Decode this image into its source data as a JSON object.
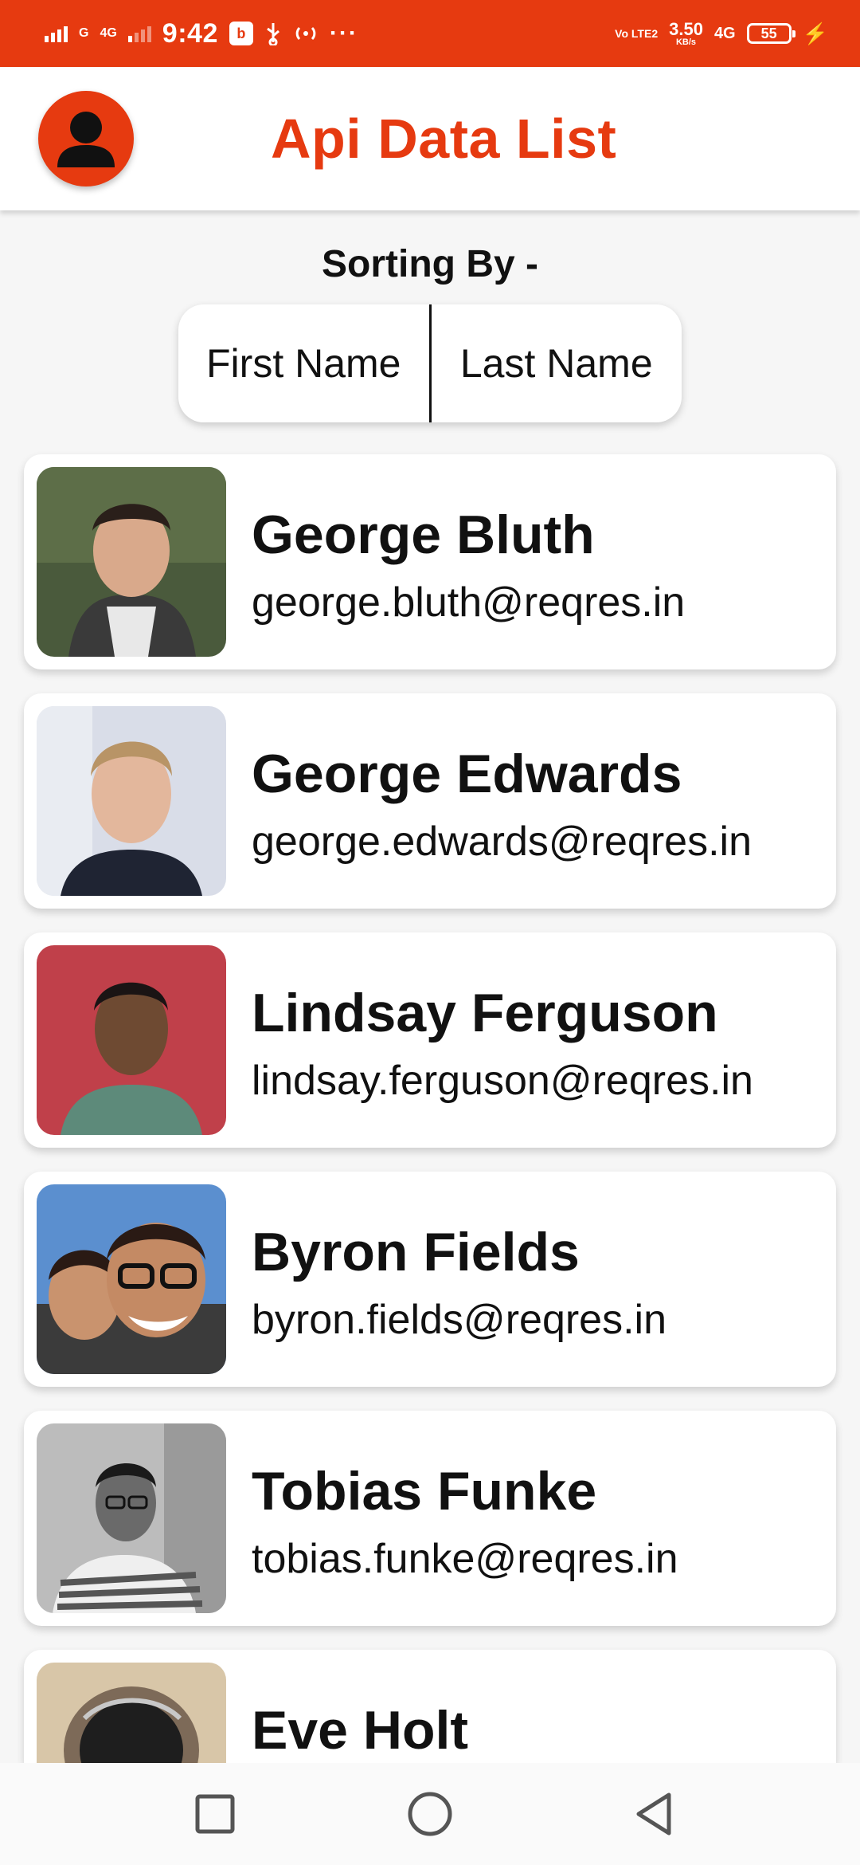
{
  "status_bar": {
    "network_1": "G",
    "network_2": "4G",
    "time": "9:42",
    "volte": "Vo LTE2",
    "speed_value": "3.50",
    "speed_unit": "KB/s",
    "network_3": "4G",
    "battery": "55",
    "accent": "#e63a10"
  },
  "appbar": {
    "title": "Api Data List",
    "avatar_icon": "person-icon"
  },
  "sorting": {
    "label": "Sorting By -",
    "options": [
      "First Name",
      "Last Name"
    ]
  },
  "users": [
    {
      "name": "George Bluth",
      "email": "george.bluth@reqres.in"
    },
    {
      "name": "George Edwards",
      "email": "george.edwards@reqres.in"
    },
    {
      "name": "Lindsay Ferguson",
      "email": "lindsay.ferguson@reqres.in"
    },
    {
      "name": "Byron Fields",
      "email": "byron.fields@reqres.in"
    },
    {
      "name": "Tobias Funke",
      "email": "tobias.funke@reqres.in"
    },
    {
      "name": "Eve Holt",
      "email": ""
    }
  ],
  "navbar": {
    "icons": [
      "recents-square-icon",
      "home-circle-icon",
      "back-triangle-icon"
    ]
  }
}
